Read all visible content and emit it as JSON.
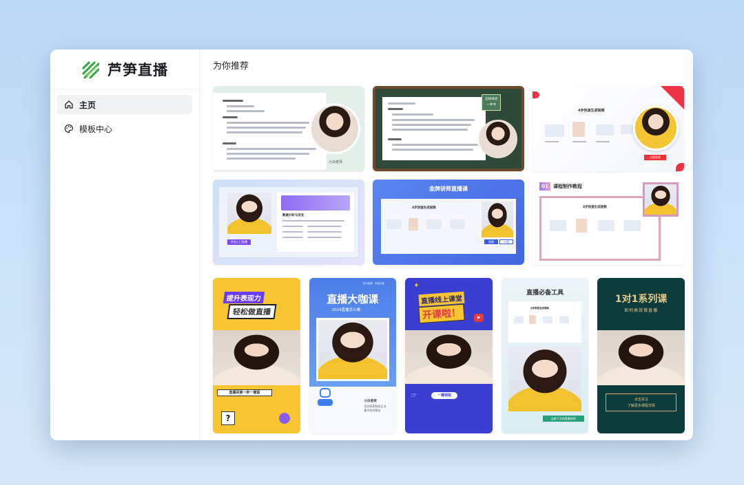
{
  "app": {
    "name": "芦笋直播"
  },
  "sidebar": {
    "items": [
      {
        "label": "主页",
        "icon": "home-icon",
        "active": true
      },
      {
        "label": "模板中心",
        "icon": "palette-icon",
        "active": false
      }
    ]
  },
  "main": {
    "section_title": "为你推荐",
    "cards_row1": [
      {
        "avatar_caption": "小白老师"
      },
      {
        "badge": "怎样讲述\n一本书"
      },
      {
        "heading": "4步快速生成视频",
        "button": "立即体验"
      }
    ],
    "cards_row2": [
      {
        "panel_title": "数据分析与优化",
        "button": "开启入门直播"
      },
      {
        "title": "金牌讲师直播课",
        "heading": "4步快速生成视频",
        "tab1": "直播",
        "tab2": "小程"
      },
      {
        "number": "01",
        "title": "课程制作教程",
        "heading": "4步快速生成视频"
      }
    ],
    "cards_row3": [
      {
        "line1": "提升表现力",
        "line2": "轻松做直播",
        "banner": "直播间第一秒一键留",
        "mark": "?"
      },
      {
        "top": "知识直播 · 流量加速",
        "title": "直播大咖课",
        "subtitle": "2024直播怎么做",
        "caption_name": "小白老师",
        "caption_text": "培训多家知名企业\n影评优秀提名"
      },
      {
        "line1": "直播线上课堂",
        "line2": "开课啦！",
        "button": "一键领取"
      },
      {
        "title": "直播必备工具",
        "heading": "4步快速生成视频",
        "button": "全新下方和直播讲师"
      },
      {
        "title": "1对1系列课",
        "subtitle": "如何高效做直播",
        "footer1": "点击关注",
        "footer2": "了解更多课程详情"
      }
    ]
  },
  "colors": {
    "accent_green": "#3aa84a",
    "nav_active_bg": "#f2f3f5",
    "blue": "#4a6ef0",
    "yellow": "#f7c531",
    "teal_dark": "#0e3b3b"
  }
}
